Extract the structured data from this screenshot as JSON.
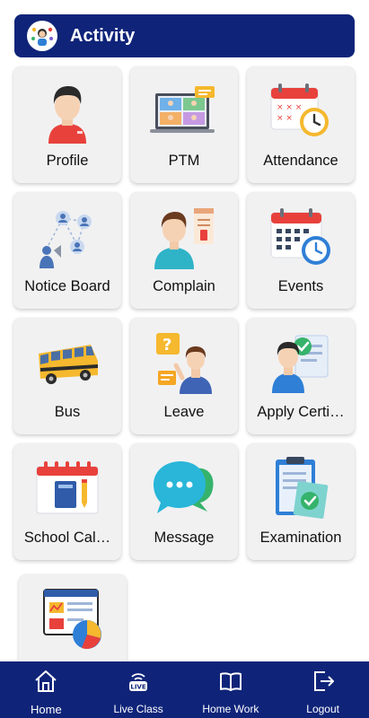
{
  "header": {
    "title": "Activity",
    "avatar_icon": "student-activity-icon"
  },
  "tiles": [
    {
      "label": "Profile",
      "icon": "profile-icon"
    },
    {
      "label": "PTM",
      "icon": "ptm-icon"
    },
    {
      "label": "Attendance",
      "icon": "attendance-icon"
    },
    {
      "label": "Notice Board",
      "icon": "notice-board-icon"
    },
    {
      "label": "Complain",
      "icon": "complain-icon"
    },
    {
      "label": "Events",
      "icon": "events-icon"
    },
    {
      "label": "Bus",
      "icon": "bus-icon"
    },
    {
      "label": "Leave",
      "icon": "leave-icon"
    },
    {
      "label": "Apply Certi…",
      "icon": "apply-certificate-icon"
    },
    {
      "label": "School Cal…",
      "icon": "school-calendar-icon"
    },
    {
      "label": "Message",
      "icon": "message-icon"
    },
    {
      "label": "Examination",
      "icon": "examination-icon"
    },
    {
      "label": "",
      "icon": "report-icon"
    }
  ],
  "bottom_nav": [
    {
      "label": "Home",
      "icon": "home-icon"
    },
    {
      "label": "Live Class",
      "icon": "live-class-icon",
      "badge": "LIVE"
    },
    {
      "label": "Home Work",
      "icon": "book-icon"
    },
    {
      "label": "Logout",
      "icon": "logout-icon"
    }
  ],
  "colors": {
    "primary": "#0f2479",
    "tile_bg": "#f1f1f2",
    "accent_red": "#e8413c",
    "accent_blue": "#2f7fd6",
    "accent_yellow": "#f5b82e"
  }
}
